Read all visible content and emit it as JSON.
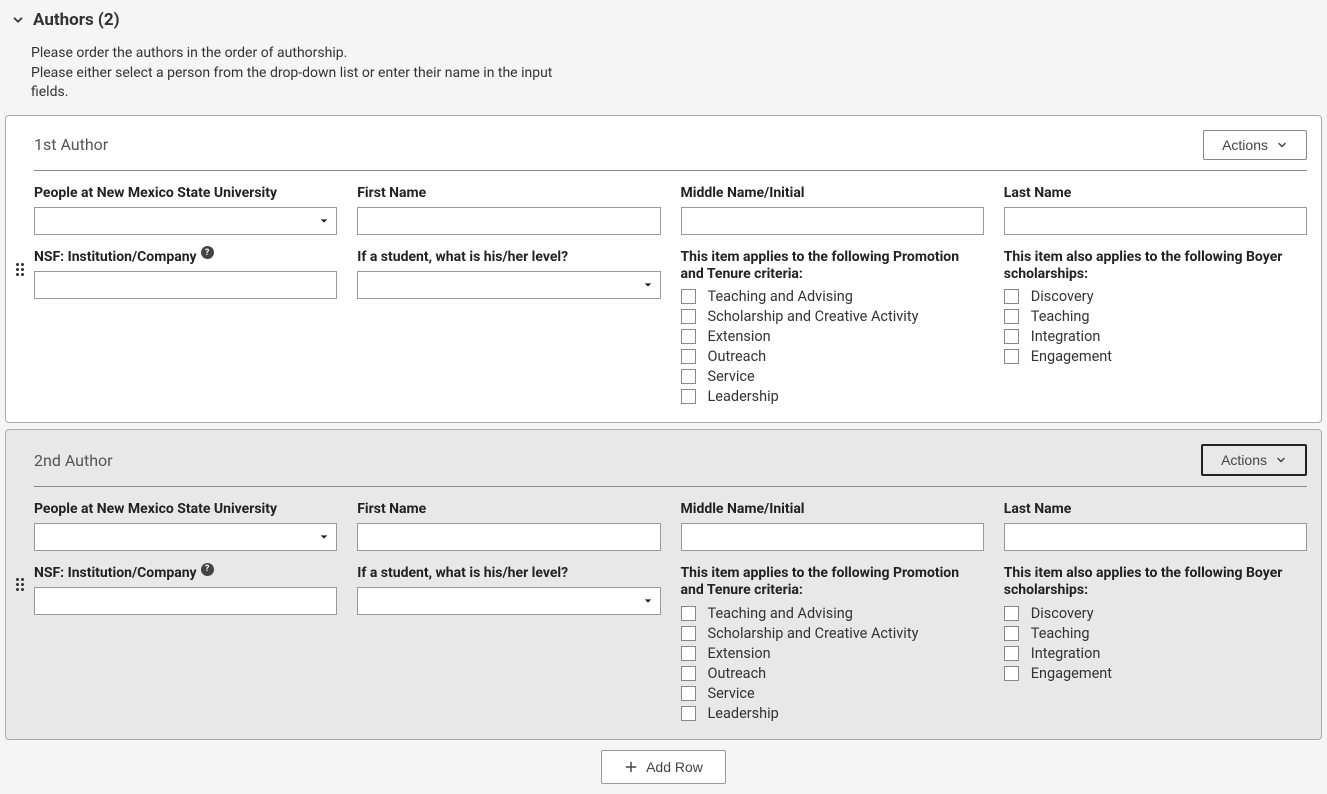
{
  "section": {
    "title": "Authors (2)",
    "instruction1": "Please order the authors in the order of authorship.",
    "instruction2": "Please either select a person from the drop-down list or enter their name in the input fields."
  },
  "actionsLabel": "Actions",
  "addRowLabel": "Add Row",
  "labels": {
    "people": "People at New Mexico State University",
    "firstName": "First Name",
    "middleName": "Middle Name/Initial",
    "lastName": "Last Name",
    "nsf": "NSF: Institution/Company",
    "studentLevel": "If a student, what is his/her level?",
    "ptCriteria": "This item applies to the following Promotion and Tenure criteria:",
    "boyer": "This item also applies to the following Boyer scholarships:"
  },
  "ptOptions": [
    "Teaching and Advising",
    "Scholarship and Creative Activity",
    "Extension",
    "Outreach",
    "Service",
    "Leadership"
  ],
  "boyerOptions": [
    "Discovery",
    "Teaching",
    "Integration",
    "Engagement"
  ],
  "authors": [
    {
      "title": "1st Author",
      "people": "",
      "firstName": "",
      "middleName": "",
      "lastName": "",
      "nsf": "",
      "studentLevel": ""
    },
    {
      "title": "2nd Author",
      "people": "",
      "firstName": "",
      "middleName": "",
      "lastName": "",
      "nsf": "",
      "studentLevel": ""
    }
  ]
}
